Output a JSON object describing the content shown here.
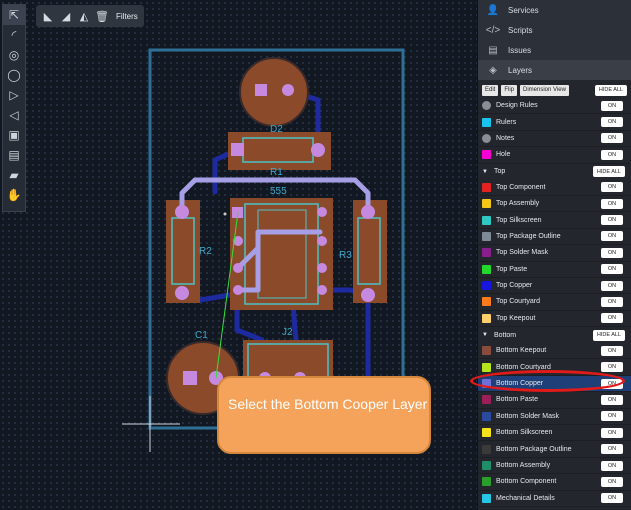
{
  "canvas": {
    "refs": {
      "d2": "D2",
      "r1": "R1",
      "u555": "555",
      "r2": "R2",
      "r3": "R3",
      "c1": "C1",
      "j2": "J2"
    }
  },
  "topbar": {
    "filters_label": "Filters"
  },
  "toolbar": {
    "items": [
      "select-tool",
      "arc-tool",
      "circle-tool",
      "circle-outline-tool",
      "polygon-tool",
      "triangle-tool",
      "image-tool",
      "note-tool",
      "ruler-tool",
      "pan-tool"
    ]
  },
  "panel": {
    "nav": {
      "services": "Services",
      "scripts": "Scripts",
      "issues": "Issues",
      "layers": "Layers"
    },
    "layer_tools": {
      "edit": "Edit",
      "flip": "Flip",
      "dimension_view": "Dimension View",
      "hide_all": "HIDE ALL"
    },
    "general_layers": [
      {
        "label": "Design Rules",
        "color": "#8a8d91",
        "shape": "round",
        "state": "ON"
      },
      {
        "label": "Rulers",
        "color": "#19c3f0",
        "shape": "square",
        "state": "ON"
      },
      {
        "label": "Notes",
        "color": "#8a8d91",
        "shape": "round",
        "state": "ON"
      },
      {
        "label": "Hole",
        "color": "#ff00d4",
        "shape": "square",
        "state": "ON"
      }
    ],
    "top_section": {
      "label": "Top",
      "hide_all": "HIDE ALL"
    },
    "top_layers": [
      {
        "label": "Top Component",
        "color": "#e52222",
        "state": "ON"
      },
      {
        "label": "Top Assembly",
        "color": "#f5c518",
        "state": "ON"
      },
      {
        "label": "Top Silkscreen",
        "color": "#2ec9c2",
        "state": "ON"
      },
      {
        "label": "Top Package Outline",
        "color": "#7f8b96",
        "state": "ON"
      },
      {
        "label": "Top Solder Mask",
        "color": "#8a1e8f",
        "state": "ON"
      },
      {
        "label": "Top Paste",
        "color": "#22d82a",
        "state": "ON"
      },
      {
        "label": "Top Copper",
        "color": "#1616e0",
        "state": "ON"
      },
      {
        "label": "Top Courtyard",
        "color": "#ff7a1a",
        "state": "ON"
      },
      {
        "label": "Top Keepout",
        "color": "#ffd06a",
        "state": "ON"
      }
    ],
    "bottom_section": {
      "label": "Bottom",
      "hide_all": "HIDE ALL"
    },
    "bottom_layers": [
      {
        "label": "Bottom Keepout",
        "color": "#8a4b3c",
        "state": "ON"
      },
      {
        "label": "Bottom Courtyard",
        "color": "#b5e61d",
        "state": "ON"
      },
      {
        "label": "Bottom Copper",
        "color": "#6f6fd8",
        "state": "ON",
        "selected": true
      },
      {
        "label": "Bottom Paste",
        "color": "#9c1f5a",
        "state": "ON"
      },
      {
        "label": "Bottom Solder Mask",
        "color": "#2a4aa0",
        "state": "ON"
      },
      {
        "label": "Bottom Silkscreen",
        "color": "#f5e21a",
        "state": "ON"
      },
      {
        "label": "Bottom Package Outline",
        "color": "#3a3a3a",
        "state": "ON"
      },
      {
        "label": "Bottom Assembly",
        "color": "#1f8f6a",
        "state": "ON"
      },
      {
        "label": "Bottom Component",
        "color": "#2a9f2a",
        "state": "ON"
      },
      {
        "label": "Mechanical Details",
        "color": "#25c6e6",
        "state": "ON"
      }
    ]
  },
  "callout": {
    "text": "Select the Bottom Cooper Layer"
  },
  "colors": {
    "copper_pad": "#8b4a2a",
    "pad": "#c58ae0",
    "trace": "#a79fe6",
    "bottom_trace": "#1d2aa0",
    "board_outline": "#2f6f96",
    "silk": "#4cc1c8",
    "accent_red": "#e21a1a",
    "callout": "#f5a25a"
  }
}
